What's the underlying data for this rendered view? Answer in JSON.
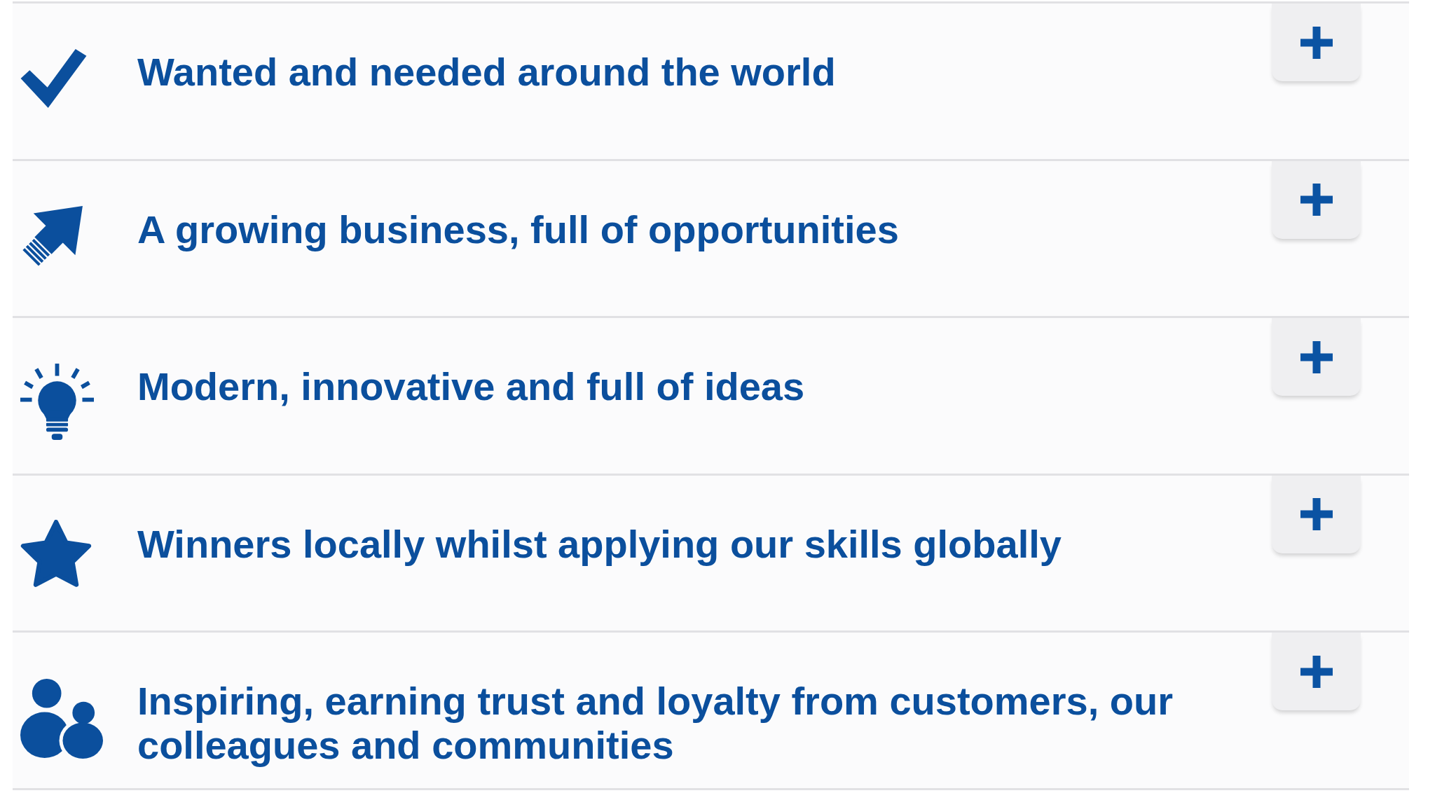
{
  "accordion": {
    "items": [
      {
        "kind": "check",
        "title": "Wanted and needed around the world",
        "expanded": false
      },
      {
        "kind": "arrow",
        "title": "A growing business, full of opportunities",
        "expanded": false
      },
      {
        "kind": "bulb",
        "title": "Modern, innovative and full of ideas",
        "expanded": false
      },
      {
        "kind": "star",
        "title": "Winners locally whilst applying our skills globally",
        "expanded": false
      },
      {
        "kind": "people",
        "title": "Inspiring, earning trust and loyalty from customers, our colleagues and communities",
        "expanded": false
      }
    ]
  }
}
